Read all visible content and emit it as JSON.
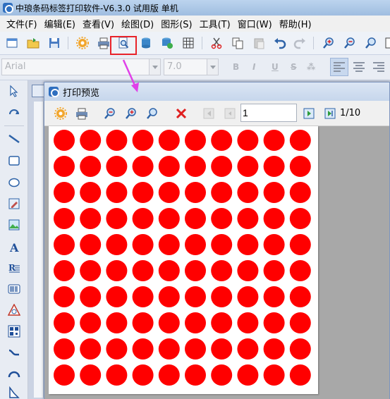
{
  "app": {
    "title": "中琅条码标签打印软件-V6.3.0 试用版 单机"
  },
  "menu": [
    {
      "label": "文件(F)"
    },
    {
      "label": "编辑(E)"
    },
    {
      "label": "查看(V)"
    },
    {
      "label": "绘图(D)"
    },
    {
      "label": "图形(S)"
    },
    {
      "label": "工具(T)"
    },
    {
      "label": "窗口(W)"
    },
    {
      "label": "帮助(H)"
    }
  ],
  "toolbar": {
    "icons": [
      "new-icon",
      "open-icon",
      "save-icon",
      "settings-icon",
      "print-icon",
      "print-preview-icon",
      "database-icon",
      "database-settings-icon",
      "grid-icon",
      "cut-icon",
      "copy-icon",
      "paste-icon",
      "undo-icon",
      "redo-icon",
      "zoom-in-icon",
      "zoom-out-icon",
      "zoom-fit-icon",
      "zoom-actual-icon"
    ],
    "highlight_color": "#e8232a"
  },
  "format_bar": {
    "font_name": "Arial",
    "font_size": "7.0",
    "bold": "B",
    "italic": "I",
    "underline": "U",
    "strike": "S"
  },
  "left_tools": [
    "select-icon",
    "rotate-icon",
    "line-icon",
    "rectangle-icon",
    "ellipse-icon",
    "image-edit-icon",
    "picture-icon",
    "text-icon",
    "rich-text-icon",
    "barcode-icon",
    "shape-icon",
    "qrcode-icon",
    "curve-icon",
    "arc-icon",
    "polygon-icon"
  ],
  "preview": {
    "title": "打印预览",
    "page_input_value": "1",
    "page_count": "1/10",
    "icons": [
      "settings-icon",
      "print-icon",
      "zoom-out-icon",
      "zoom-in-icon",
      "zoom-fit-icon",
      "close-icon",
      "first-page-icon",
      "prev-page-icon",
      "next-page-icon",
      "last-page-icon"
    ],
    "label_grid": {
      "columns": 10,
      "rows": 10,
      "color": "#ff0000"
    }
  },
  "annotation": {
    "arrow_color": "#e040e8"
  }
}
